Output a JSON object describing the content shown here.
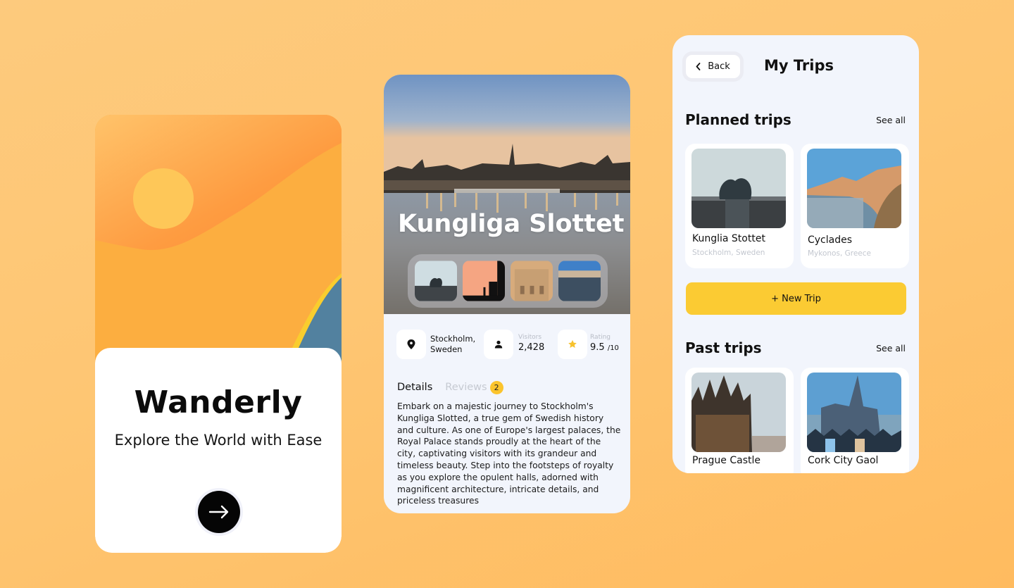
{
  "splash": {
    "brand": "Wanderly",
    "tagline": "Explore the World with Ease",
    "next_icon": "arrow-right-icon",
    "colors": {
      "sky": "#fcae40",
      "sun": "#fec758",
      "band": "#fd8c33",
      "hill": "#52819f",
      "hill_edge": "#f9cd2e"
    }
  },
  "detail": {
    "title": "Kungliga Slottet",
    "gallery": [
      "statue-photo",
      "sunset-silhouette-photo",
      "palace-facade-photo",
      "harbor-photo"
    ],
    "location": {
      "icon": "map-pin-icon",
      "line1": "Stockholm,",
      "line2": "Sweden"
    },
    "visitors": {
      "icon": "person-icon",
      "label": "Visitors",
      "value": "2,428"
    },
    "rating": {
      "icon": "star-icon",
      "label": "Rating",
      "value": "9.5",
      "unit": "/10"
    },
    "tabs": {
      "details": "Details",
      "reviews": "Reviews",
      "reviews_count": "2"
    },
    "description": "Embark on a majestic journey to Stockholm's Kungliga Slotted, a true gem of Swedish history and culture. As one of Europe's largest palaces, the Royal Palace stands proudly at the heart of the city, captivating visitors with its grandeur and timeless beauty. Step into the footsteps of royalty as you explore the opulent halls, adorned with magnificent architecture, intricate details, and priceless treasures"
  },
  "trips": {
    "back_label": "Back",
    "title": "My Trips",
    "planned": {
      "title": "Planned trips",
      "see_all": "See all",
      "items": [
        {
          "name": "Kunglia Stottet",
          "location": "Stockholm, Sweden"
        },
        {
          "name": "Cyclades",
          "location": "Mykonos, Greece"
        }
      ]
    },
    "new_trip_label": "+ New Trip",
    "past": {
      "title": "Past trips",
      "see_all": "See all",
      "items": [
        {
          "name": "Prague Castle"
        },
        {
          "name": "Cork City Gaol"
        }
      ]
    },
    "accent": "#fbcb33"
  }
}
